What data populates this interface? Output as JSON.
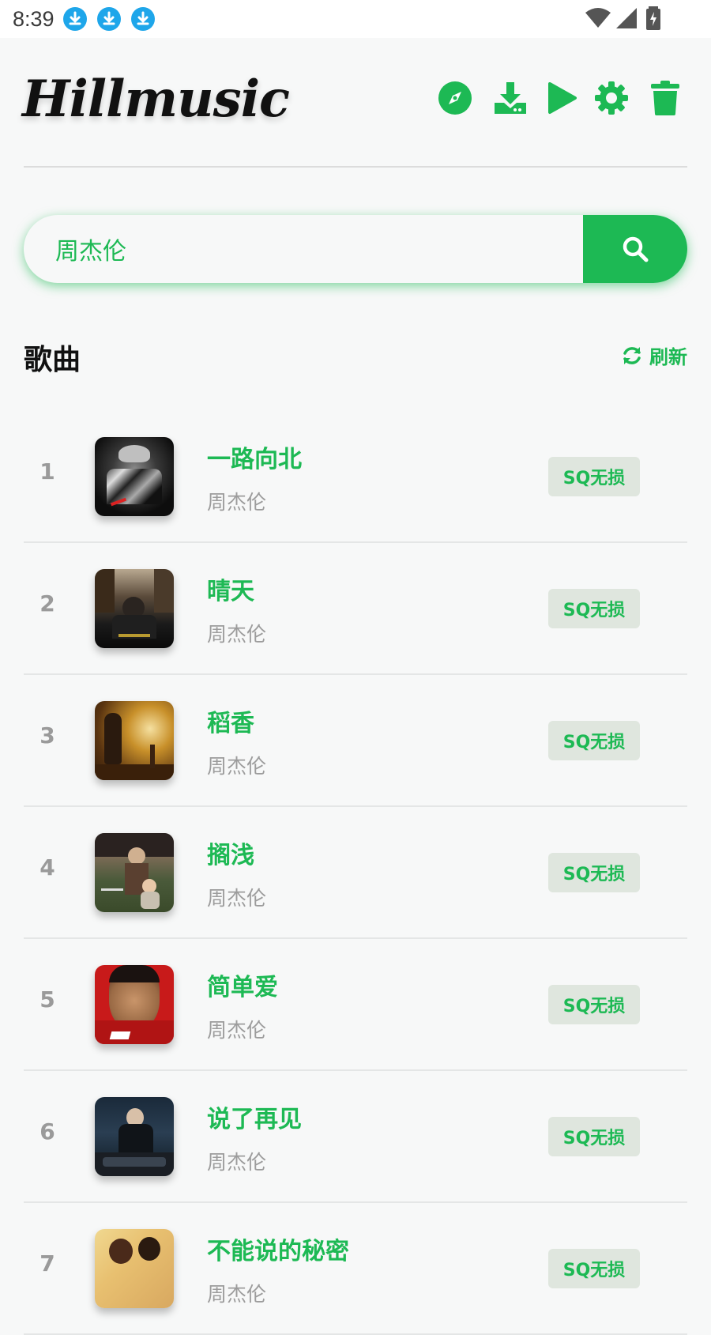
{
  "status_bar": {
    "time": "8:39"
  },
  "header": {
    "app_name": "Hillmusic"
  },
  "search": {
    "value": "周杰伦"
  },
  "section": {
    "title": "歌曲",
    "refresh_label": "刷新"
  },
  "songs": [
    {
      "index": "1",
      "title": "一路向北",
      "artist": "周杰伦",
      "badge": "SQ无损"
    },
    {
      "index": "2",
      "title": "晴天",
      "artist": "周杰伦",
      "badge": "SQ无损"
    },
    {
      "index": "3",
      "title": "稻香",
      "artist": "周杰伦",
      "badge": "SQ无损"
    },
    {
      "index": "4",
      "title": "搁浅",
      "artist": "周杰伦",
      "badge": "SQ无损"
    },
    {
      "index": "5",
      "title": "简单爱",
      "artist": "周杰伦",
      "badge": "SQ无损"
    },
    {
      "index": "6",
      "title": "说了再见",
      "artist": "周杰伦",
      "badge": "SQ无损"
    },
    {
      "index": "7",
      "title": "不能说的秘密",
      "artist": "周杰伦",
      "badge": "SQ无损"
    }
  ],
  "colors": {
    "accent": "#1db954",
    "badge_bg": "#dfe6de",
    "muted": "#9c9c9c"
  }
}
